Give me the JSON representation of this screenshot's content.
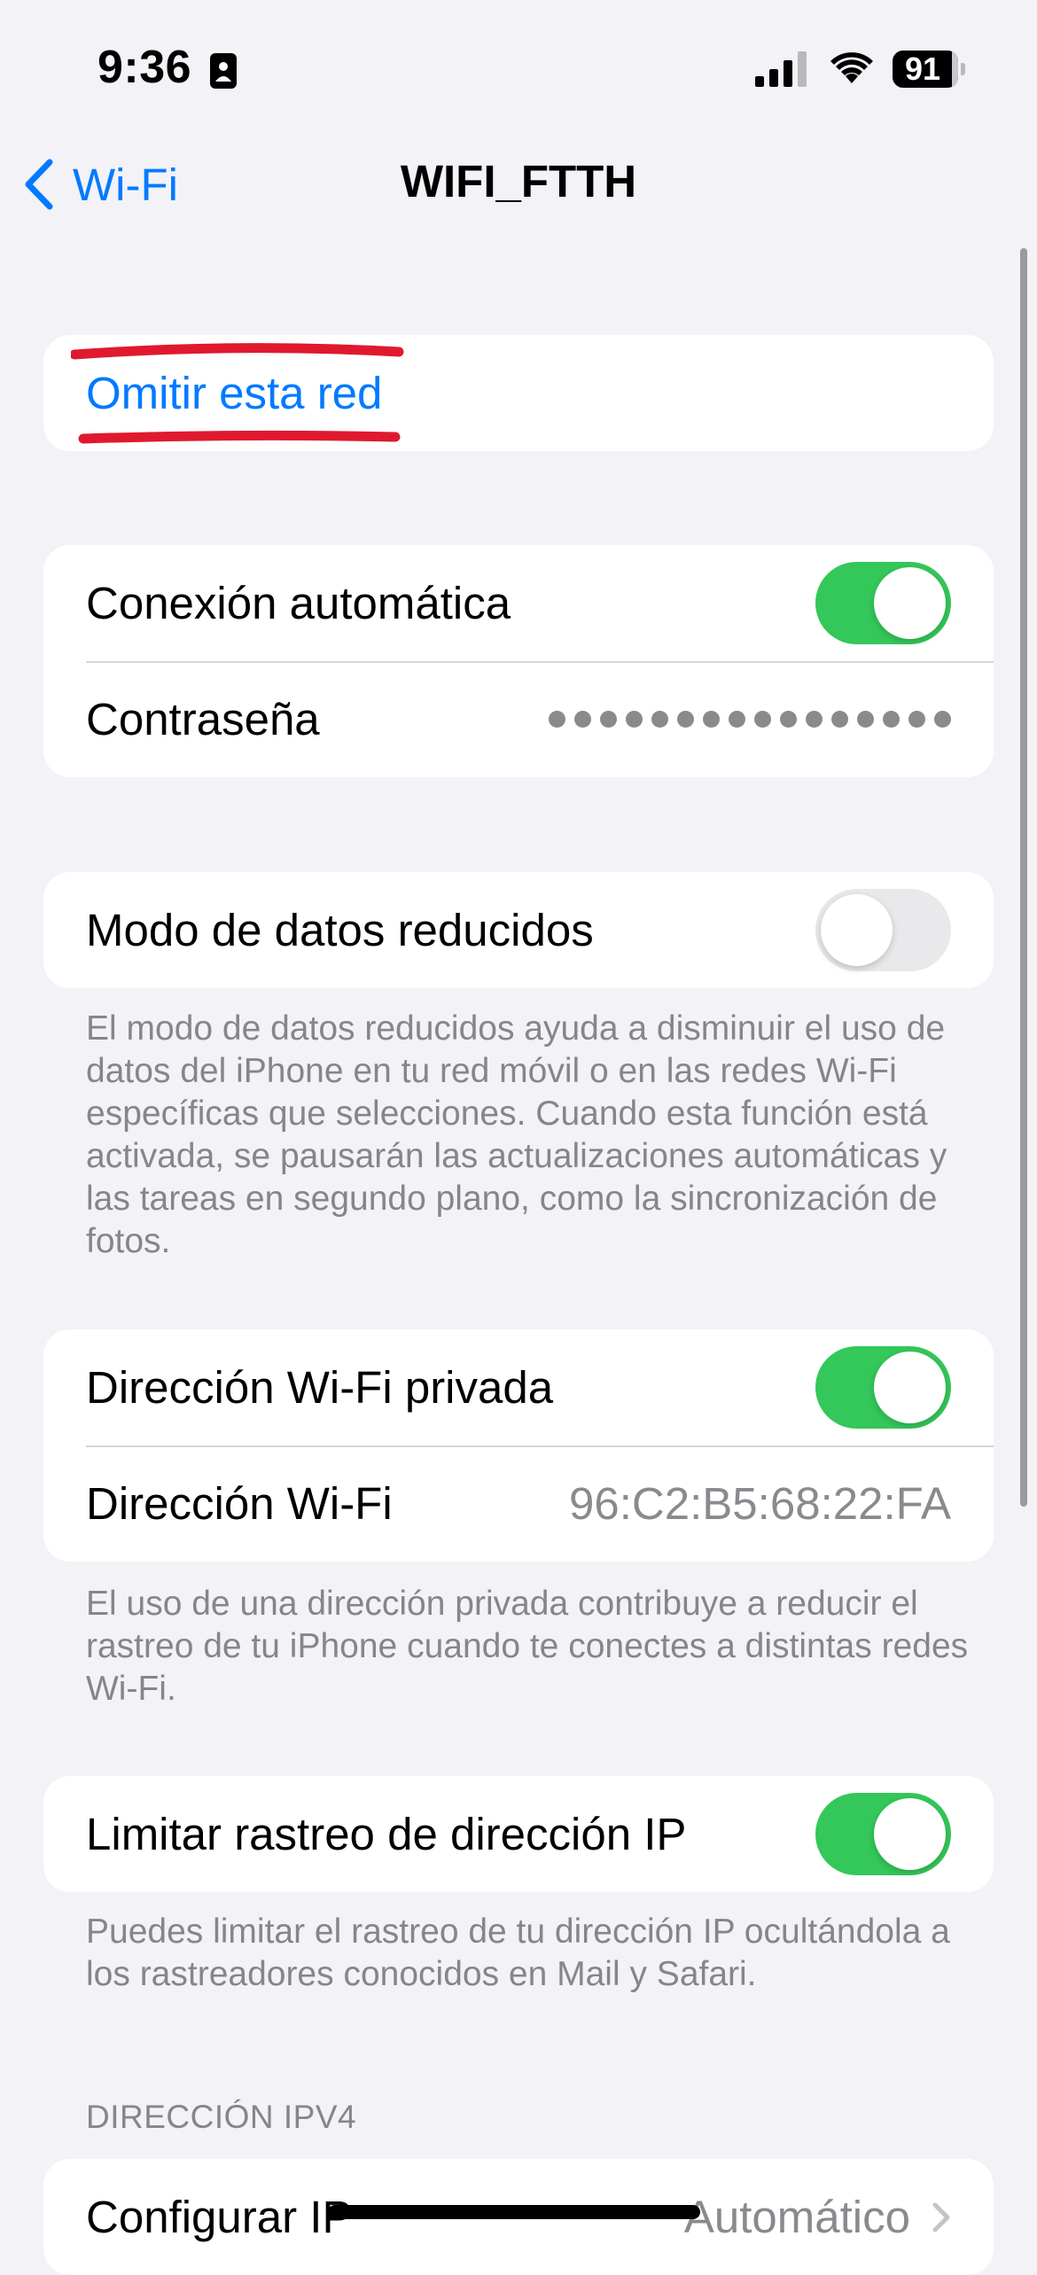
{
  "status_bar": {
    "time": "9:36",
    "battery_level": "91",
    "icons": [
      "focus-icon",
      "signal-icon",
      "wifi-icon",
      "battery-icon"
    ]
  },
  "nav": {
    "back_label": "Wi-Fi",
    "title": "WIFI_FTTH"
  },
  "forget": {
    "label": "Omitir esta red"
  },
  "auto_join": {
    "label": "Conexión automática",
    "on": true
  },
  "password": {
    "label": "Contraseña",
    "masked_length": 16
  },
  "low_data": {
    "label": "Modo de datos reducidos",
    "on": false,
    "footer": "El modo de datos reducidos ayuda a disminuir el uso de datos del iPhone en tu red móvil o en las redes Wi-Fi específicas que selecciones. Cuando esta función está activada, se pausarán las actualizaciones automáticas y las tareas en segundo plano, como la sincronización de fotos."
  },
  "private_address": {
    "label": "Dirección Wi-Fi privada",
    "on": true,
    "address_label": "Dirección Wi-Fi",
    "address_value": "96:C2:B5:68:22:FA",
    "footer": "El uso de una dirección privada contribuye a reducir el rastreo de tu iPhone cuando te conectes a distintas redes Wi-Fi."
  },
  "limit_ip": {
    "label": "Limitar rastreo de dirección IP",
    "on": true,
    "footer": "Puedes limitar el rastreo de tu dirección IP ocultándola a los rastreadores conocidos en Mail y Safari."
  },
  "ipv4": {
    "header": "DIRECCIÓN IPV4",
    "configure_label": "Configurar IP",
    "configure_value": "Automático"
  },
  "colors": {
    "accent": "#007AFF",
    "toggle_on": "#34C759",
    "highlight": "#E0192E",
    "background": "#F2F2F7"
  }
}
